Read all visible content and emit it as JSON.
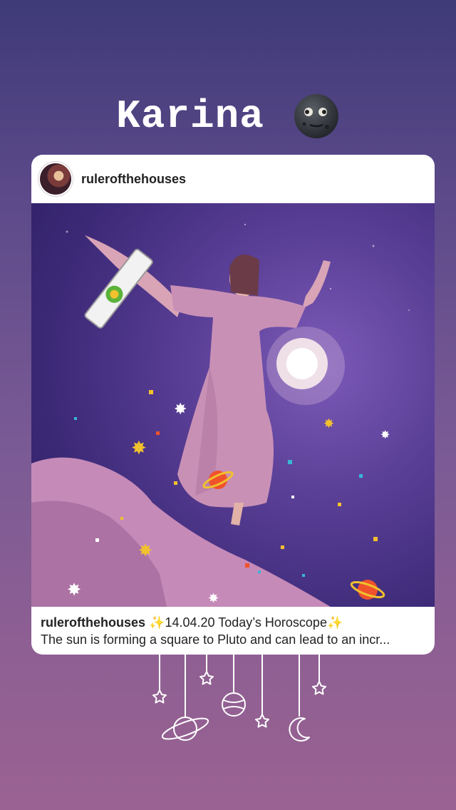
{
  "story": {
    "title": "Karina",
    "title_emoji": "new-moon-face-icon"
  },
  "post": {
    "username": "rulerofthehouses",
    "caption_user": "rulerofthehouses",
    "caption_title": "✨14.04.20 Today’s Horoscope✨",
    "caption_text": "The sun is forming a square to Pluto and can lead to an incr..."
  },
  "colors": {
    "background_top": "#3f3a78",
    "background_bottom": "#9a6292",
    "card": "#ffffff"
  }
}
